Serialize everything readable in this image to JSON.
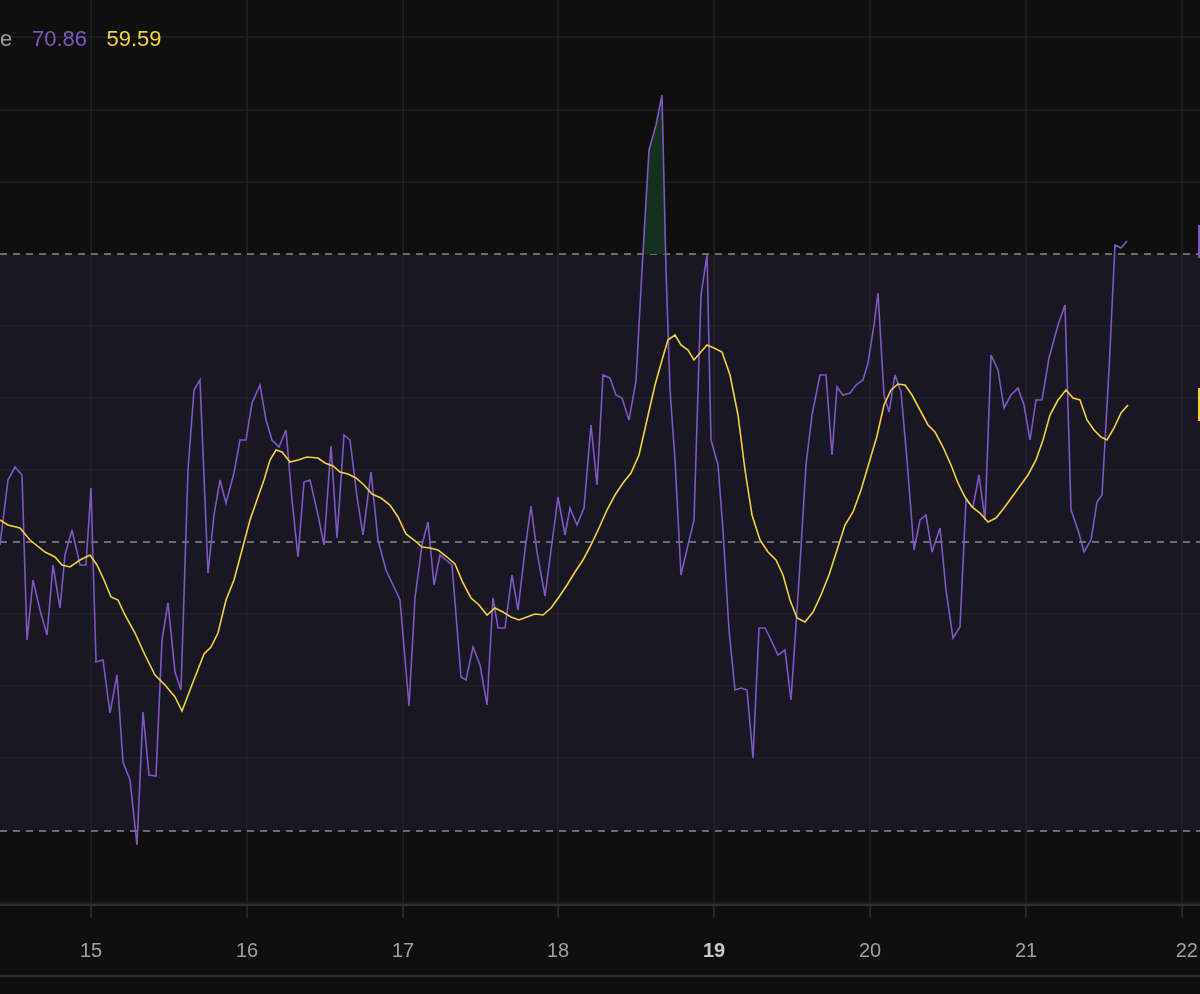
{
  "legend": {
    "label": "e",
    "values": [
      {
        "text": "70.86",
        "color": "#7e57c2"
      },
      {
        "text": "59.59",
        "color": "#f2d33c"
      }
    ]
  },
  "time_axis": {
    "labels": [
      {
        "text": "15",
        "emphasized": false
      },
      {
        "text": "16",
        "emphasized": false
      },
      {
        "text": "17",
        "emphasized": false
      },
      {
        "text": "18",
        "emphasized": false
      },
      {
        "text": "19",
        "emphasized": true
      },
      {
        "text": "20",
        "emphasized": false
      },
      {
        "text": "21",
        "emphasized": false
      },
      {
        "text": "22",
        "emphasized": false
      }
    ]
  }
}
